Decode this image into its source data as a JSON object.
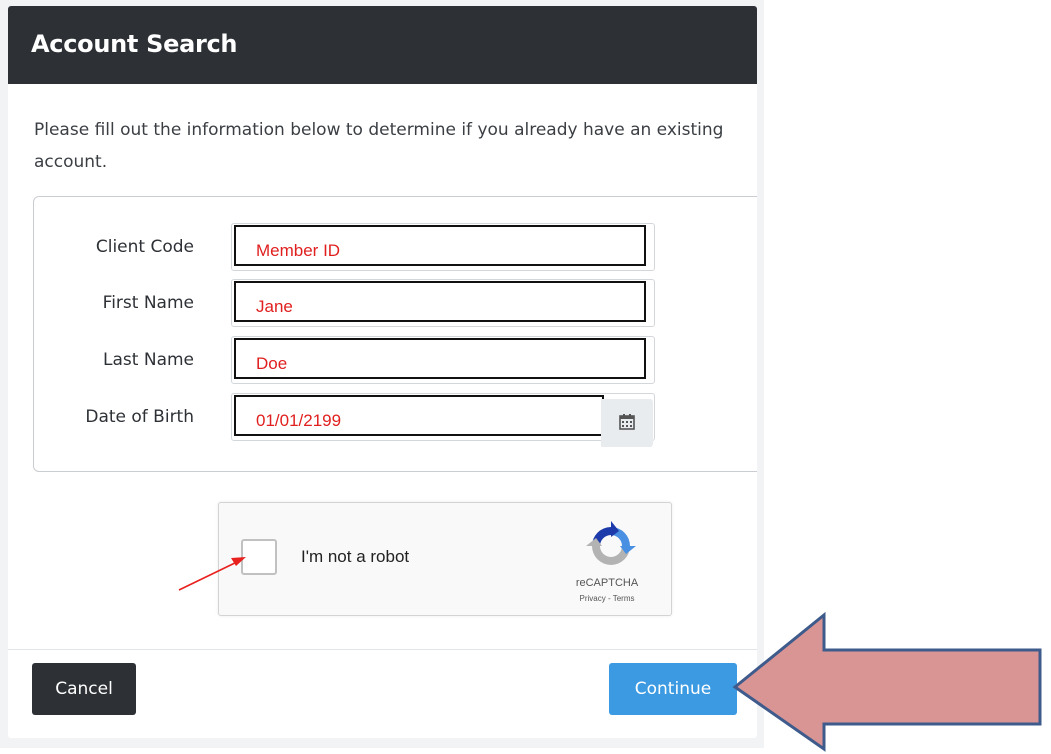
{
  "modal": {
    "title": "Account Search",
    "intro": "Please fill out the information below to determine if you already have an existing account."
  },
  "form": {
    "fields": [
      {
        "label": "Client Code",
        "value": "Member ID"
      },
      {
        "label": "First Name",
        "value": "Jane"
      },
      {
        "label": "Last Name",
        "value": "Doe"
      },
      {
        "label": "Date of Birth",
        "value": "01/01/2199"
      }
    ],
    "calendar_icon": "calendar-icon"
  },
  "recaptcha": {
    "label": "I'm not a robot",
    "brand": "reCAPTCHA",
    "terms": "Privacy - Terms",
    "logo_icon": "recaptcha-logo-icon"
  },
  "footer": {
    "cancel_label": "Cancel",
    "continue_label": "Continue"
  },
  "annotations": {
    "small_arrow_color": "#e8201e",
    "big_arrow_fill": "#d99594",
    "big_arrow_stroke": "#3e5b8c"
  },
  "colors": {
    "header_bg": "#2d3136",
    "continue_bg": "#3b9ae1",
    "input_text": "#e0201f"
  }
}
